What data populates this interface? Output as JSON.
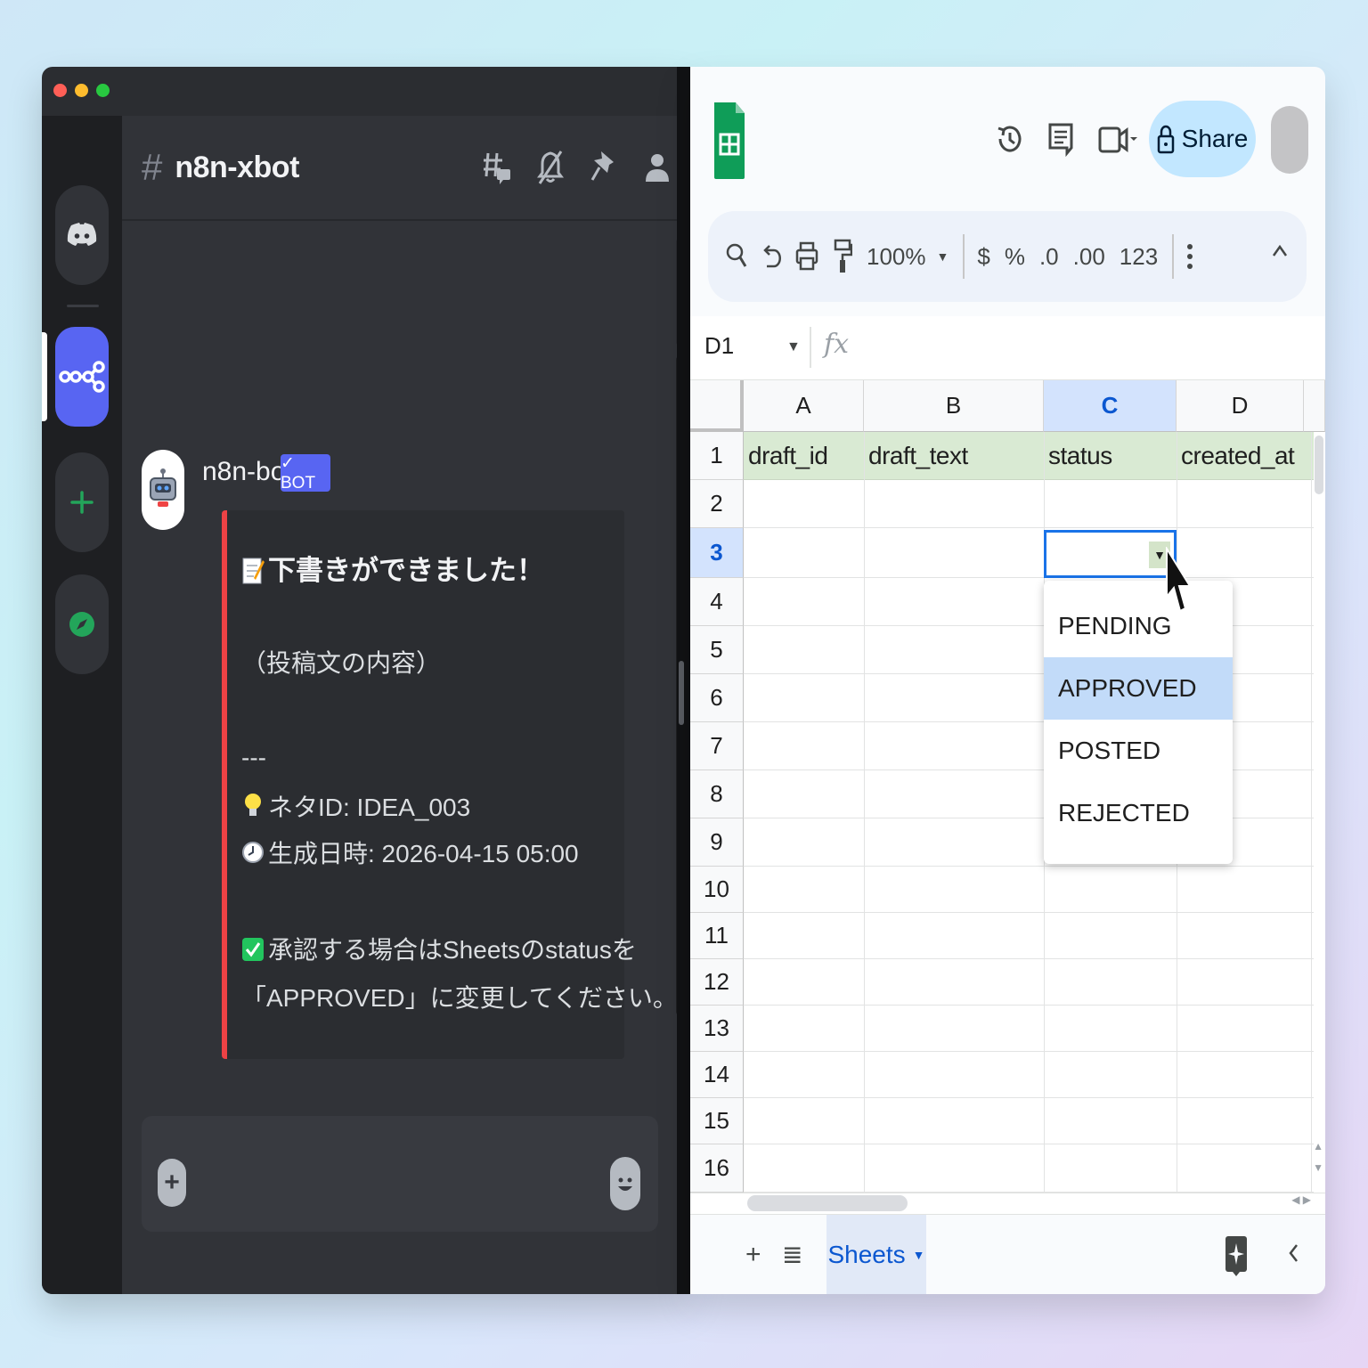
{
  "discord": {
    "channel_name": "n8n-xbot",
    "channel_hash": "#",
    "message": {
      "author": "n8n-bot",
      "badge": "✓ BOT",
      "embed_lines": [
        "下書きができました！",
        "（投稿文の内容）",
        "---",
        "ネタID: IDEA_003",
        "生成日時: 2026-04-15 05:00",
        "承認する場合はSheetsのstatusを",
        "「APPROVED」に変更してください。"
      ]
    },
    "composer_plus": "+",
    "embed_color": "#ed4245",
    "accent": "#5865f2"
  },
  "sheets": {
    "share_label": "Share",
    "zoom": "100%",
    "toolbar": {
      "currency": "$",
      "percent": "%",
      "decrease_decimal": ".0",
      "increase_decimal": ".00",
      "number_format": "123"
    },
    "name_box": "D1",
    "fx": "fx",
    "columns": [
      "A",
      "B",
      "C",
      "D"
    ],
    "rows": [
      "1",
      "2",
      "3",
      "4",
      "5",
      "6",
      "7",
      "8",
      "9",
      "10",
      "11",
      "12",
      "13",
      "14",
      "15",
      "16"
    ],
    "header_cells": [
      "draft_id",
      "draft_text",
      "status",
      "created_at"
    ],
    "dropdown_options": [
      "PENDING",
      "APPROVED",
      "POSTED",
      "REJECTED"
    ],
    "dropdown_highlighted": "APPROVED",
    "sheet_tab": "Sheets",
    "header_fill": "#d9ead3",
    "selection_color": "#1a73e8"
  }
}
